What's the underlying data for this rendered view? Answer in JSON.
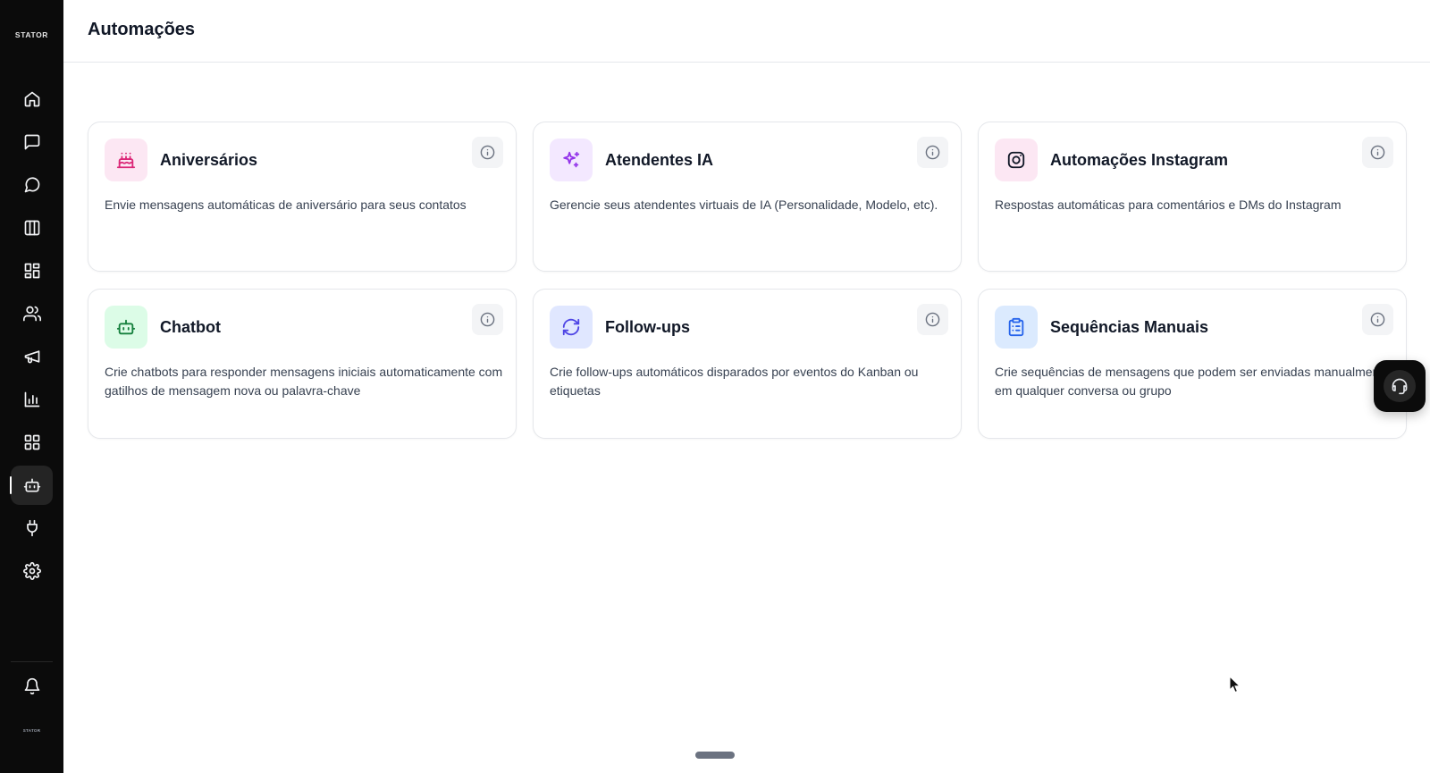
{
  "app": {
    "logo_text": "STATOR",
    "mini_logo_text": "STATOR"
  },
  "header": {
    "title": "Automações"
  },
  "sidebar": {
    "items": [
      {
        "name": "home",
        "icon": "home-icon",
        "active": false
      },
      {
        "name": "messages",
        "icon": "message-square-icon",
        "active": false
      },
      {
        "name": "chat",
        "icon": "message-circle-icon",
        "active": false
      },
      {
        "name": "kanban",
        "icon": "columns-icon",
        "active": false
      },
      {
        "name": "dashboard",
        "icon": "layout-dashboard-icon",
        "active": false
      },
      {
        "name": "contacts",
        "icon": "users-icon",
        "active": false
      },
      {
        "name": "campaigns",
        "icon": "megaphone-icon",
        "active": false
      },
      {
        "name": "reports",
        "icon": "bar-chart-icon",
        "active": false
      },
      {
        "name": "apps",
        "icon": "grid-icon",
        "active": false
      },
      {
        "name": "automations",
        "icon": "bot-icon",
        "active": true
      },
      {
        "name": "integrations",
        "icon": "plug-icon",
        "active": false
      },
      {
        "name": "settings",
        "icon": "gear-icon",
        "active": false
      }
    ],
    "bottom": {
      "icon": "bell-icon"
    }
  },
  "cards": [
    {
      "title": "Aniversários",
      "description": "Envie mensagens automáticas de aniversário para seus contatos",
      "icon": "cake-icon",
      "icon_bg": "#fce7f3",
      "icon_color": "#db2777"
    },
    {
      "title": "Atendentes IA",
      "description": "Gerencie seus atendentes virtuais de IA (Personalidade, Modelo, etc).",
      "icon": "sparkles-icon",
      "icon_bg": "#f3e8ff",
      "icon_color": "#9333ea"
    },
    {
      "title": "Automações Instagram",
      "description": "Respostas automáticas para comentários e DMs do Instagram",
      "icon": "instagram-icon",
      "icon_bg": "#fce7f3",
      "icon_color": "#111827"
    },
    {
      "title": "Chatbot",
      "description": "Crie chatbots para responder mensagens iniciais automaticamente com gatilhos de mensagem nova ou palavra-chave",
      "icon": "bot-icon",
      "icon_bg": "#dcfce7",
      "icon_color": "#15803d"
    },
    {
      "title": "Follow-ups",
      "description": "Crie follow-ups automáticos disparados por eventos do Kanban ou etiquetas",
      "icon": "refresh-icon",
      "icon_bg": "#e0e7ff",
      "icon_color": "#4f46e5"
    },
    {
      "title": "Sequências Manuais",
      "description": "Crie sequências de mensagens que podem ser enviadas manualmente em qualquer conversa ou grupo",
      "icon": "clipboard-list-icon",
      "icon_bg": "#dbeafe",
      "icon_color": "#2563eb"
    }
  ],
  "support": {
    "icon": "headset-icon"
  }
}
